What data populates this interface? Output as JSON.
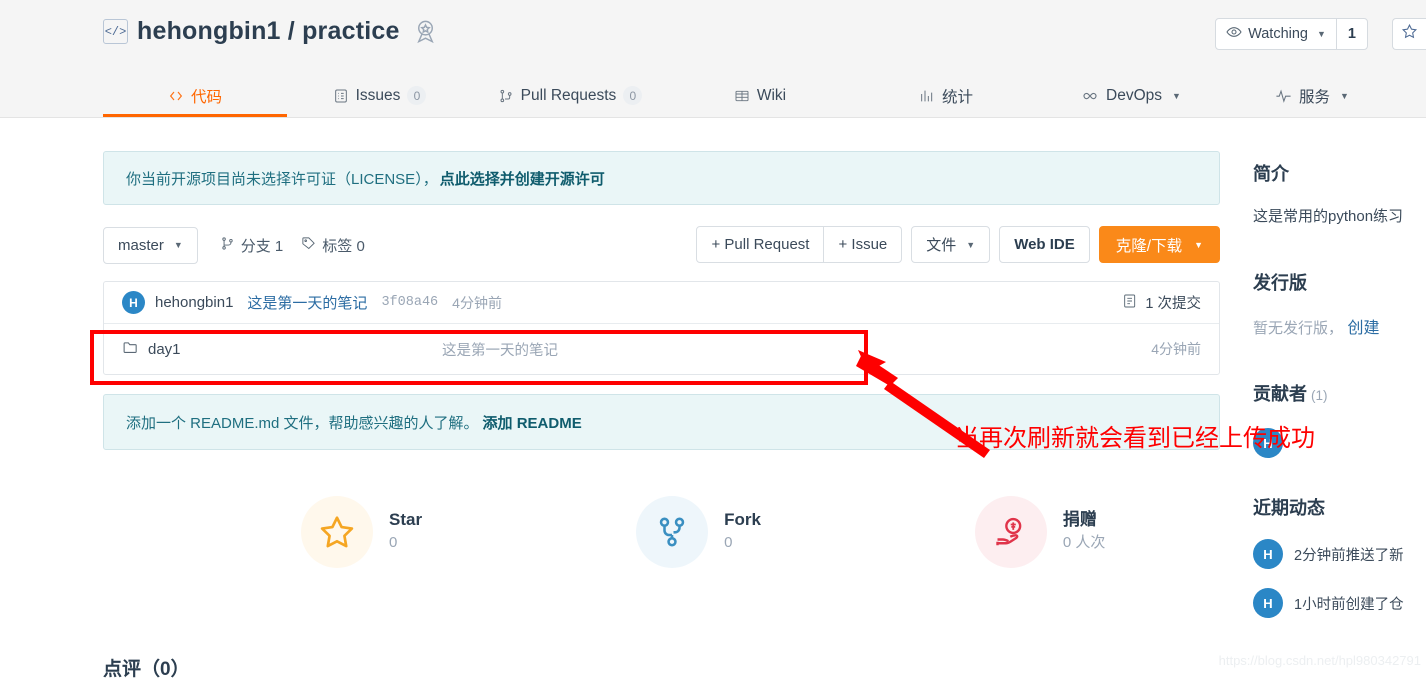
{
  "header": {
    "repo_owner": "hehongbin1",
    "repo_separator": "/",
    "repo_name": "practice",
    "repo_full": "hehongbin1 / practice",
    "code_icon": "code-brackets-icon",
    "badge_icon": "award-ribbon-icon",
    "watch_label": "Watching",
    "watch_count": "1",
    "watch_icon": "eye-icon",
    "star_icon": "star-outline-icon"
  },
  "tabs": [
    {
      "label": "代码",
      "icon": "code-icon",
      "count": null,
      "active": true,
      "dropdown": false
    },
    {
      "label": "Issues",
      "icon": "issues-icon",
      "count": "0",
      "active": false,
      "dropdown": false
    },
    {
      "label": "Pull Requests",
      "icon": "pull-request-icon",
      "count": "0",
      "active": false,
      "dropdown": false
    },
    {
      "label": "Wiki",
      "icon": "book-icon",
      "count": null,
      "active": false,
      "dropdown": false
    },
    {
      "label": "统计",
      "icon": "chart-bar-icon",
      "count": null,
      "active": false,
      "dropdown": false
    },
    {
      "label": "DevOps",
      "icon": "infinity-icon",
      "count": null,
      "active": false,
      "dropdown": true
    },
    {
      "label": "服务",
      "icon": "pulse-icon",
      "count": null,
      "active": false,
      "dropdown": true
    }
  ],
  "license_banner": {
    "text": "你当前开源项目尚未选择许可证（LICENSE），",
    "link": "点此选择并创建开源许可"
  },
  "toolbar": {
    "branch": "master",
    "branches_label": "分支 1",
    "branches_icon": "branch-icon",
    "tags_label": "标签 0",
    "tags_icon": "tag-icon",
    "pull_request_btn": "+ Pull Request",
    "issue_btn": "+ Issue",
    "files_btn": "文件",
    "webide_btn": "Web IDE",
    "clone_btn": "克隆/下载"
  },
  "commit": {
    "avatar_letter": "H",
    "author": "hehongbin1",
    "message": "这是第一天的笔记",
    "hash": "3f08a46",
    "time": "4分钟前",
    "count_label": "1 次提交",
    "count_icon": "commit-list-icon"
  },
  "files": [
    {
      "icon": "folder-icon",
      "name": "day1",
      "description": "这是第一天的笔记",
      "time": "4分钟前"
    }
  ],
  "readme_banner": {
    "text": "添加一个 README.md 文件，帮助感兴趣的人了解。",
    "link": "添加 README"
  },
  "actions": [
    {
      "name": "Star",
      "value": "0",
      "icon": "star-icon",
      "color": "#f5a623"
    },
    {
      "name": "Fork",
      "value": "0",
      "icon": "fork-icon",
      "color": "#3a8fc1"
    },
    {
      "name": "捐赠",
      "value": "0 人次",
      "icon": "donate-hand-icon",
      "color": "#e0344a"
    }
  ],
  "reviews": {
    "title": "点评（0）"
  },
  "sidebar": {
    "intro_heading": "简介",
    "intro_text": "这是常用的python练习",
    "release_heading": "发行版",
    "release_empty": "暂无发行版，",
    "release_link": "创建",
    "contributors_heading": "贡献者",
    "contributors_count": "(1)",
    "contributor_avatar_letter": "H",
    "activity_heading": "近期动态",
    "activities": [
      {
        "avatar_letter": "H",
        "text": "2分钟前推送了新"
      },
      {
        "avatar_letter": "H",
        "text": "1小时前创建了仓"
      }
    ]
  },
  "annotation": {
    "text": "当再次刷新就会看到已经上传成功",
    "color": "#fe0000",
    "rect_name": "highlight-rectangle",
    "arrow_name": "pointer-arrow"
  },
  "watermark": "https://blog.csdn.net/hpl980342791",
  "colors": {
    "accent_orange": "#ff6600",
    "primary_button": "#fa8919",
    "banner_bg": "#eaf6f7",
    "link_blue": "#2b6ca3",
    "annotation_red": "#fe0000"
  }
}
